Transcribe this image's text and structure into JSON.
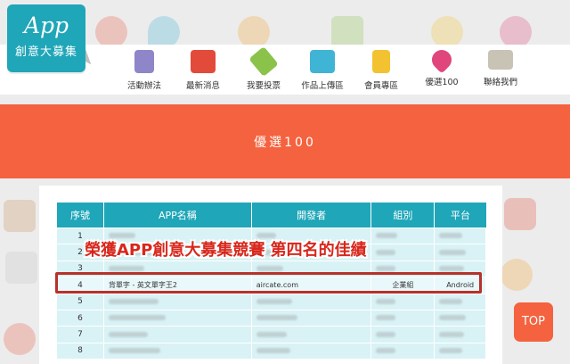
{
  "logo": {
    "line1": "App",
    "line2": "創意大募集"
  },
  "nav": [
    {
      "label": "活動辦法",
      "icon": "document-list-icon",
      "color": "#8e86c8"
    },
    {
      "label": "最新消息",
      "icon": "chat-bubbles-icon",
      "color": "#e24b3a"
    },
    {
      "label": "我要投票",
      "icon": "tag-icon",
      "color": "#8bc34a"
    },
    {
      "label": "作品上傳區",
      "icon": "cloud-upload-icon",
      "color": "#3fb4d4"
    },
    {
      "label": "會員專區",
      "icon": "member-id-icon",
      "color": "#f3c230"
    },
    {
      "label": "優選100",
      "icon": "heart-icon",
      "color": "#e0457b"
    },
    {
      "label": "聯絡我們",
      "icon": "mail-icon",
      "color": "#c9c3b5"
    }
  ],
  "banner": {
    "title": "優選100",
    "color": "#f4623f"
  },
  "table": {
    "headers": [
      "序號",
      "APP名稱",
      "開發者",
      "組別",
      "平台"
    ],
    "rows": [
      {
        "no": "1"
      },
      {
        "no": "2"
      },
      {
        "no": "3"
      },
      {
        "no": "4",
        "name": "背單字 - 英文單字王2",
        "developer": "aircate.com",
        "group": "企業組",
        "platform": "Android"
      },
      {
        "no": "5"
      },
      {
        "no": "6"
      },
      {
        "no": "7"
      },
      {
        "no": "8"
      }
    ]
  },
  "caption": "榮獲APP創意大募集競賽 第四名的佳績",
  "top_button": "TOP",
  "colors": {
    "accent": "#1fa6b8",
    "highlight_border": "#b8312a",
    "caption": "#d8271c"
  }
}
